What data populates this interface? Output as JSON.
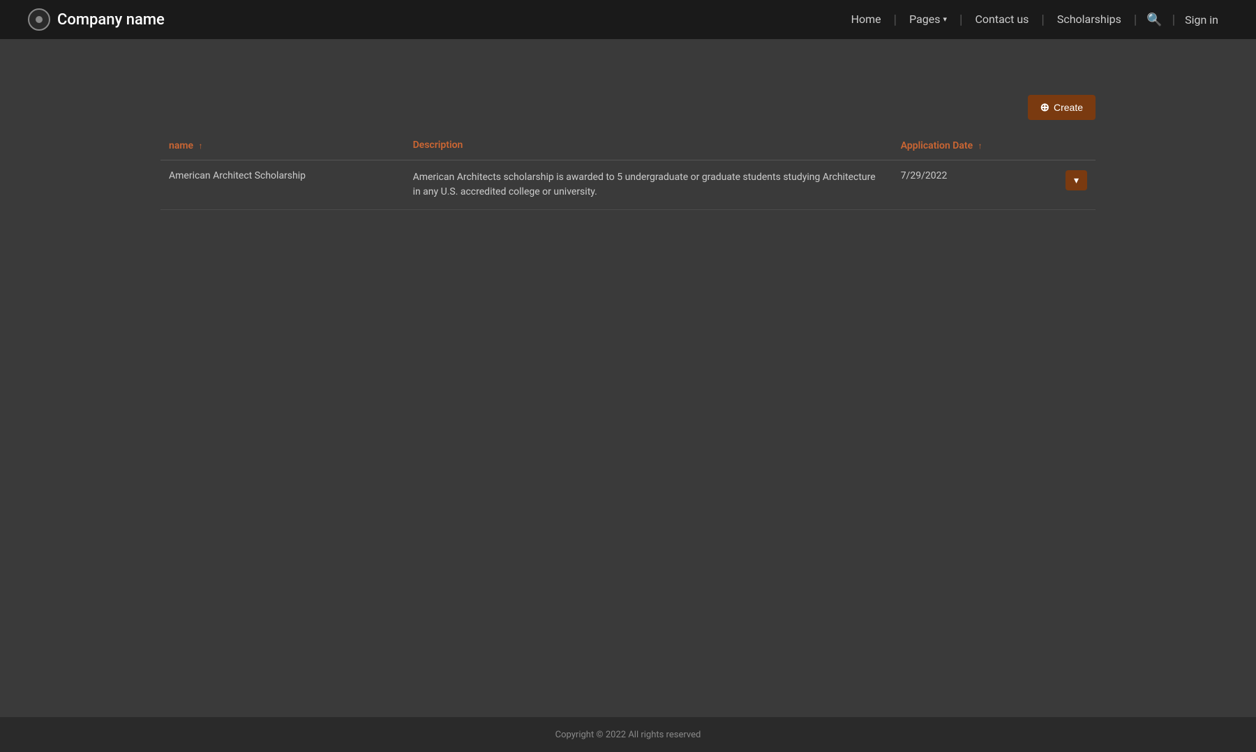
{
  "navbar": {
    "brand_name": "Company name",
    "nav_items": [
      {
        "label": "Home",
        "id": "home"
      },
      {
        "label": "Pages",
        "id": "pages",
        "has_dropdown": true
      },
      {
        "label": "Contact us",
        "id": "contact"
      },
      {
        "label": "Scholarships",
        "id": "scholarships"
      }
    ],
    "sign_in_label": "Sign in",
    "search_icon": "🔍"
  },
  "toolbar": {
    "create_label": "Create",
    "create_icon": "+"
  },
  "table": {
    "columns": [
      {
        "label": "name",
        "id": "name",
        "sortable": true
      },
      {
        "label": "Description",
        "id": "description",
        "sortable": false
      },
      {
        "label": "Application Date",
        "id": "app_date",
        "sortable": true
      }
    ],
    "rows": [
      {
        "name": "American Architect Scholarship",
        "description": "American Architects scholarship is awarded to 5 undergraduate or graduate students studying Architecture in any U.S. accredited college or university.",
        "application_date": "7/29/2022"
      }
    ],
    "action_dropdown_icon": "▾"
  },
  "footer": {
    "copyright": "Copyright © 2022  All rights reserved"
  }
}
